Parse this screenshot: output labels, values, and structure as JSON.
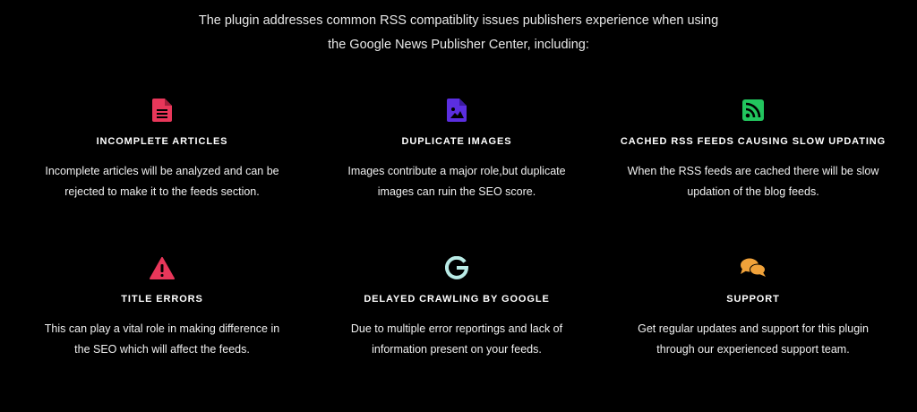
{
  "intro": {
    "line1": "The plugin addresses common RSS compatiblity issues publishers experience when using",
    "line2": "the Google News Publisher Center, including:"
  },
  "features": [
    {
      "icon": "document-icon",
      "color": "#e8375a",
      "title": "INCOMPLETE ARTICLES",
      "desc1": "Incomplete articles will be analyzed and can be",
      "desc2": "rejected to make it to the feeds section."
    },
    {
      "icon": "image-file-icon",
      "color": "#5b2ee0",
      "title": "DUPLICATE IMAGES",
      "desc1": "Images contribute a major role,but duplicate",
      "desc2": "images can ruin the SEO score."
    },
    {
      "icon": "rss-icon",
      "color": "#22c55e",
      "title": "CACHED RSS FEEDS CAUSING SLOW UPDATING",
      "desc1": "When the RSS feeds are cached there will be slow",
      "desc2": "updation of the blog feeds."
    },
    {
      "icon": "warning-icon",
      "color": "#e8375a",
      "title": "TITLE ERRORS",
      "desc1": "This can play a vital role in making difference in",
      "desc2": "the SEO which will affect the feeds."
    },
    {
      "icon": "google-icon",
      "color": "#b9ebe6",
      "title": "DELAYED CRAWLING BY GOOGLE",
      "desc1": "Due to multiple error reportings and lack of",
      "desc2": "information present on your feeds."
    },
    {
      "icon": "chat-bubbles-icon",
      "color": "#f0a23a",
      "title": "SUPPORT",
      "desc1": "Get regular updates and support for this plugin",
      "desc2": "through our experienced support team."
    }
  ]
}
